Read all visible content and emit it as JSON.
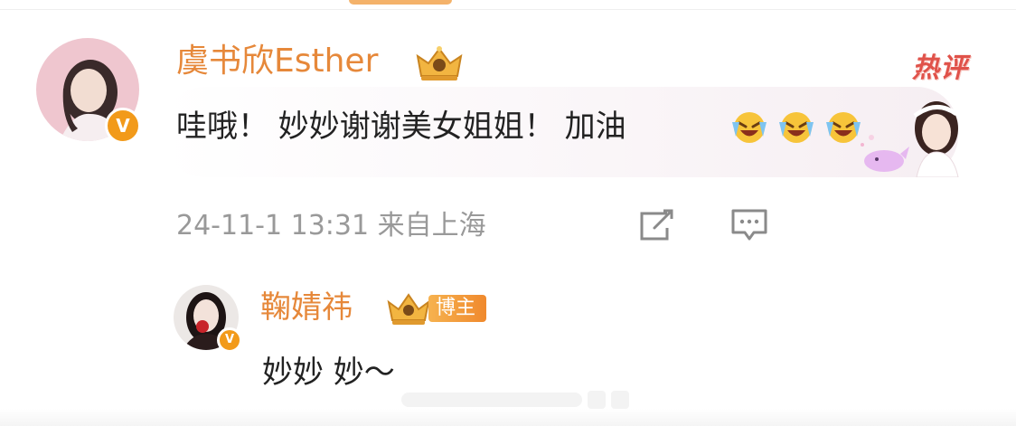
{
  "comment": {
    "username": "虞书欣Esther",
    "hot_label": "热评",
    "text": "哇哦！ 妙妙谢谢美女姐姐！ 加油",
    "emojis": [
      "laugh-cry-emoji",
      "laugh-cry-emoji",
      "laugh-cry-emoji"
    ],
    "meta": "24-11-1 13:31 来自上海",
    "actions": [
      "repost-icon",
      "reply-icon"
    ]
  },
  "reply": {
    "username": "鞠婧祎",
    "author_badge": "博主",
    "text": "妙妙 妙～"
  },
  "verified_badge_text": "V",
  "colors": {
    "username": "#e6883a",
    "hot_label": "#e0524a",
    "verified": "#f29a1a",
    "meta": "#999999",
    "body_text": "#222222",
    "author_badge": "#f0892d"
  }
}
